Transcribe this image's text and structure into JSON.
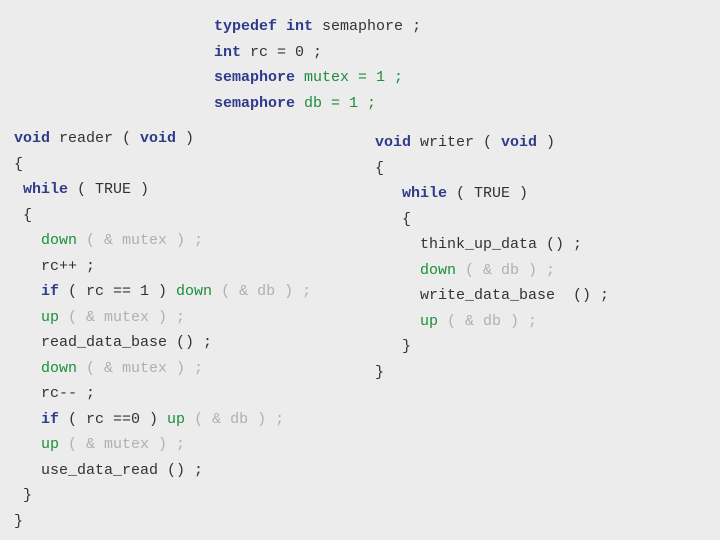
{
  "decls": {
    "typedef_kw1": "typedef",
    "typedef_kw2": "int",
    "typedef_rest": " semaphore ;",
    "rc_kw": "int",
    "rc_rest": " rc = 0 ;",
    "mutex_kw": "semaphore",
    "mutex_rest": " mutex = 1 ;",
    "db_kw": "semaphore",
    "db_rest": " db = 1 ;"
  },
  "reader": {
    "sig_void1": "void",
    "sig_name": " reader ( ",
    "sig_void2": "void",
    "sig_close": " )",
    "lbrace": "{",
    "while_kw": "while",
    "while_cond": " ( TRUE )",
    "lbrace2": "{",
    "down1_fn": "down",
    "down1_args": " ( & mutex ) ;",
    "rcpp": "rc++ ;",
    "if1_kw": "if",
    "if1_cond": " ( rc == 1 ) ",
    "if1_fn": "down",
    "if1_args": " ( & db ) ;",
    "up1_fn": "up",
    "up1_args": " ( & mutex ) ;",
    "read_call": "read_data_base () ;",
    "down2_fn": "down",
    "down2_args": " ( & mutex ) ;",
    "rcmm": "rc-- ;",
    "if2_kw": "if",
    "if2_cond": " ( rc ==0 ) ",
    "if2_fn": "up",
    "if2_args": " ( & db ) ;",
    "up2_fn": "up",
    "up2_args": " ( & mutex ) ;",
    "use_call": "use_data_read () ;",
    "rbrace2": "}",
    "rbrace": "}"
  },
  "writer": {
    "sig_void1": "void",
    "sig_name": " writer ( ",
    "sig_void2": "void",
    "sig_close": " )",
    "lbrace": "{",
    "while_kw": "while",
    "while_cond": " ( TRUE )",
    "lbrace2": "{",
    "think_call": "think_up_data () ;",
    "down_fn": "down",
    "down_args": " ( & db ) ;",
    "write_call": "write_data_base  () ;",
    "up_fn": "up",
    "up_args": " ( & db ) ;",
    "rbrace2": "}",
    "rbrace": "}"
  }
}
